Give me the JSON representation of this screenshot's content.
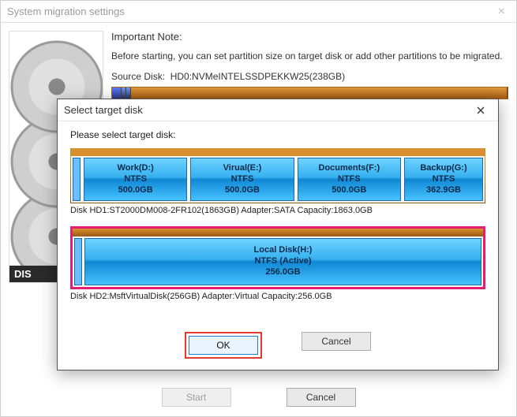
{
  "parent": {
    "title": "System migration settings",
    "disk_label": "DIS",
    "note_title": "Important Note:",
    "note_body": "Before starting, you can set partition size on target disk or add other partitions to be migrated.",
    "source_label": "Source Disk:",
    "source_disk": "HD0:NVMeINTELSSDPEKKW25(238GB)",
    "buttons": {
      "start": "Start",
      "cancel": "Cancel"
    }
  },
  "modal": {
    "title": "Select target disk",
    "prompt": "Please select target disk:",
    "disk1": {
      "partitions": [
        {
          "name": "Work(D:)",
          "fs": "NTFS",
          "size": "500.0GB"
        },
        {
          "name": "Virual(E:)",
          "fs": "NTFS",
          "size": "500.0GB"
        },
        {
          "name": "Documents(F:)",
          "fs": "NTFS",
          "size": "500.0GB"
        },
        {
          "name": "Backup(G:)",
          "fs": "NTFS",
          "size": "362.9GB"
        }
      ],
      "info": "Disk HD1:ST2000DM008-2FR102(1863GB)  Adapter:SATA  Capacity:1863.0GB"
    },
    "disk2": {
      "partition": {
        "name": "Local Disk(H:)",
        "fs": "NTFS (Active)",
        "size": "256.0GB"
      },
      "info": "Disk HD2:MsftVirtualDisk(256GB)  Adapter:Virtual  Capacity:256.0GB"
    },
    "buttons": {
      "ok": "OK",
      "cancel": "Cancel"
    }
  }
}
